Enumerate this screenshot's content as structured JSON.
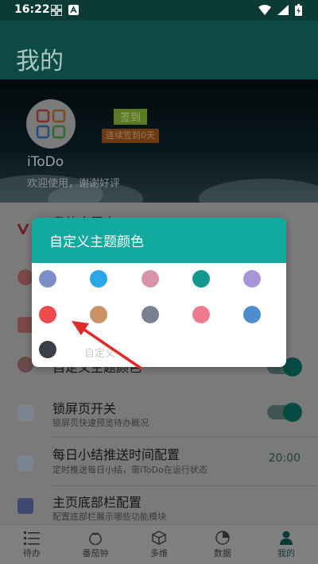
{
  "status_bar": {
    "time": "16:22",
    "icons": [
      "grid-icon",
      "a-app-icon",
      "wifi-icon",
      "signal-icon",
      "battery-charging-icon"
    ]
  },
  "app_bar": {
    "title": "我的"
  },
  "profile": {
    "app_name": "iToDo",
    "slogan": "欢迎使用，谢谢好评",
    "checkin_label": "签到",
    "streak_label": "连续签到0天"
  },
  "settings": {
    "rows": [
      {
        "title": "我的金属卡",
        "description": "",
        "value": ""
      },
      {
        "title": "",
        "description": "",
        "value": ""
      },
      {
        "title": "",
        "description": "",
        "value": ""
      },
      {
        "title": "自定义主题颜色",
        "description": "",
        "value": ""
      },
      {
        "title": "锁屏页开关",
        "description": "锁屏页快速预览待办概况",
        "value": ""
      },
      {
        "title": "每日小结推送时间配置",
        "description": "定时推送每日小结，需iToDo在运行状态",
        "value": "20:00"
      },
      {
        "title": "主页底部栏配置",
        "description": "配置底部栏展示哪些功能模块",
        "value": ""
      }
    ]
  },
  "dialog": {
    "title": "自定义主题颜色",
    "swatches": [
      "#7b8ec8",
      "#2aa7e8",
      "#d793a7",
      "#12988c",
      "#a895d7",
      "#ef4b4b",
      "#cc9268",
      "#78828f",
      "#ee7a90",
      "#4f8ccf",
      "#3b3e47"
    ],
    "custom_label": "自定义"
  },
  "bottom_nav": {
    "items": [
      {
        "label": "待办",
        "icon": "list-icon"
      },
      {
        "label": "番茄钟",
        "icon": "tomato-icon"
      },
      {
        "label": "多维",
        "icon": "cube-icon"
      },
      {
        "label": "数据",
        "icon": "pie-chart-icon"
      },
      {
        "label": "我的",
        "icon": "person-icon"
      }
    ],
    "active_index": 4
  },
  "colors": {
    "accent": "#12a99e",
    "primary_dark": "#0e4a45",
    "annotation_arrow": "#e02a2a"
  }
}
